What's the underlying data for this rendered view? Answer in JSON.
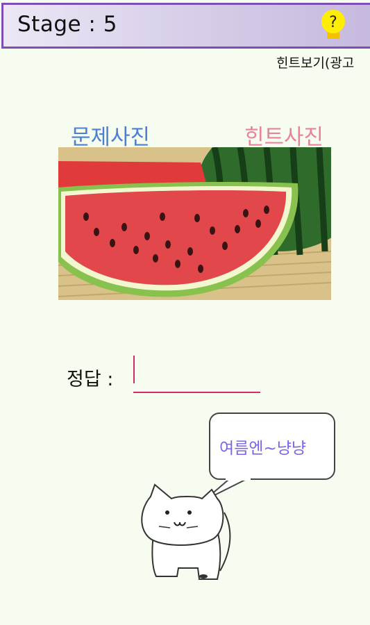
{
  "header": {
    "stage_label": "Stage : 5",
    "help_button": {
      "glyph": "?",
      "icon": "lightbulb-icon",
      "color": "#ffee00"
    }
  },
  "hint_link": "힌트보기(광고",
  "labels": {
    "problem_photo": "문제사진",
    "hint_photo": "힌트사진"
  },
  "answer": {
    "label": "정답 :",
    "value": ""
  },
  "speech_bubble": "여름엔~냥냥",
  "colors": {
    "header_border": "#7d4fb3",
    "problem_label": "#4a7fd1",
    "hint_label": "#e9829a",
    "answer_underline": "#d12b6d",
    "bubble_text": "#7b64ea",
    "background": "#f6fdf0"
  }
}
